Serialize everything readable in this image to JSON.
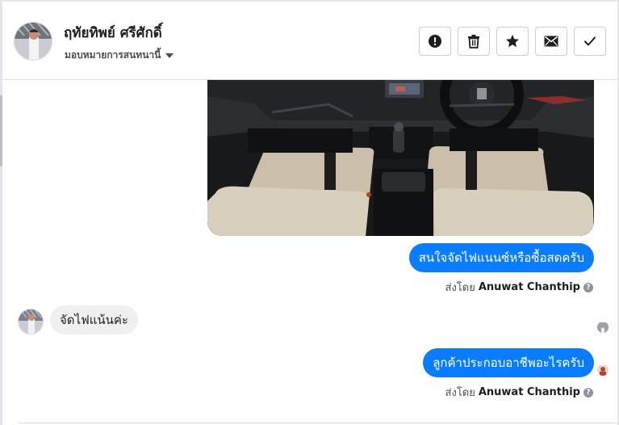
{
  "header": {
    "contact_name": "ฤทัยทิพย์ ศรีศักดิ์",
    "assign_label": "มอบหมายการสนทนานี้",
    "actions": [
      {
        "name": "mark-spam-button",
        "icon": "exclamation-circle-icon"
      },
      {
        "name": "delete-button",
        "icon": "trash-icon"
      },
      {
        "name": "star-button",
        "icon": "star-icon"
      },
      {
        "name": "mark-unread-button",
        "icon": "envelope-icon"
      },
      {
        "name": "mark-done-button",
        "icon": "check-icon"
      }
    ]
  },
  "messages": {
    "outgoing_1": {
      "text": "สนใจจัดไฟแนนซ์หรือซื้อสดครับ",
      "sent_by_prefix": "ส่งโดย",
      "agent": "Anuwat Chanthip"
    },
    "incoming_1": {
      "text": "จัดไฟแน้นค่ะ"
    },
    "outgoing_2": {
      "text": "ลูกค้าประกอบอาชีพอะไรครับ",
      "sent_by_prefix": "ส่งโดย",
      "agent": "Anuwat Chanthip"
    }
  },
  "colors": {
    "outgoing_bubble": "#0a7cff",
    "incoming_bubble": "#f0f0f0"
  }
}
